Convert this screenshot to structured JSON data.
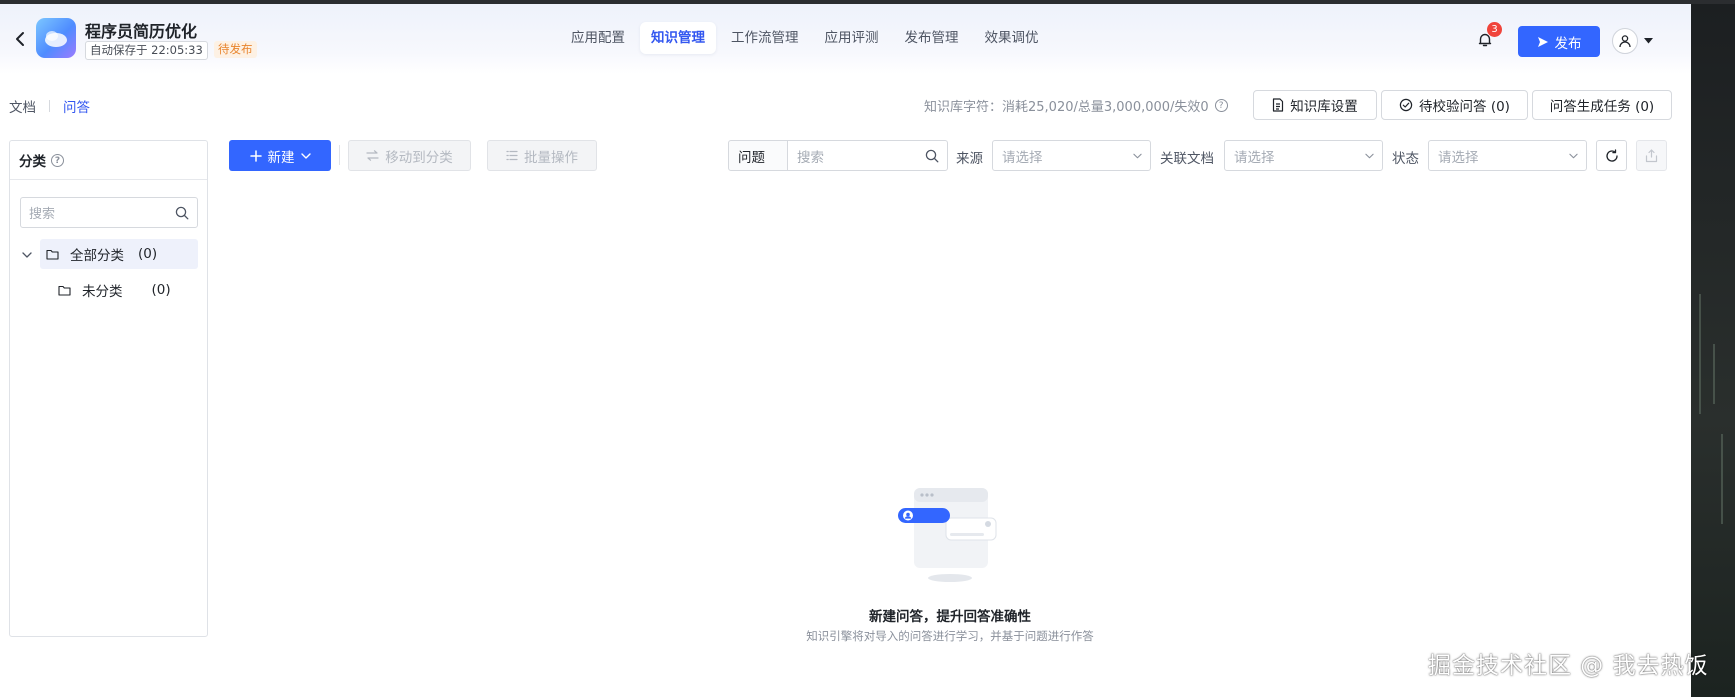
{
  "app": {
    "title": "程序员简历优化",
    "autosave": "自动保存于 22:05:33",
    "status": "待发布"
  },
  "nav": {
    "tabs": [
      {
        "label": "应用配置"
      },
      {
        "label": "知识管理"
      },
      {
        "label": "工作流管理"
      },
      {
        "label": "应用评测"
      },
      {
        "label": "发布管理"
      },
      {
        "label": "效果调优"
      }
    ],
    "active_index": 1
  },
  "header": {
    "notification_count": "3",
    "publish_label": "发布"
  },
  "subtabs": {
    "documents": "文档",
    "qa": "问答"
  },
  "quota": {
    "label": "知识库字符：消耗25,020/总量3,000,000/失效0",
    "help": "?"
  },
  "actions": {
    "kb_settings": "知识库设置",
    "pending_qa": "待校验问答 (0)",
    "qa_tasks": "问答生成任务 (0)"
  },
  "sidebar": {
    "title": "分类",
    "help": "?",
    "search_placeholder": "搜索",
    "tree": [
      {
        "label": "全部分类",
        "count": "(0)"
      },
      {
        "label": "未分类",
        "count": "(0)"
      }
    ]
  },
  "toolbar": {
    "new_label": "新建",
    "move_label": "移动到分类",
    "batch_label": "批量操作"
  },
  "filters": {
    "question_select": "问题",
    "search_placeholder": "搜索",
    "source_label": "来源",
    "source_placeholder": "请选择",
    "linked_doc_label": "关联文档",
    "linked_doc_placeholder": "请选择",
    "status_label": "状态",
    "status_placeholder": "请选择"
  },
  "empty": {
    "title": "新建问答，提升回答准确性",
    "description": "知识引擎将对导入的问答进行学习，并基于问题进行作答"
  },
  "watermark": "掘金技术社区 @ 我去热饭",
  "colors": {
    "accent": "#3366ff",
    "warning": "#e8842d",
    "badge": "#f0443b"
  }
}
